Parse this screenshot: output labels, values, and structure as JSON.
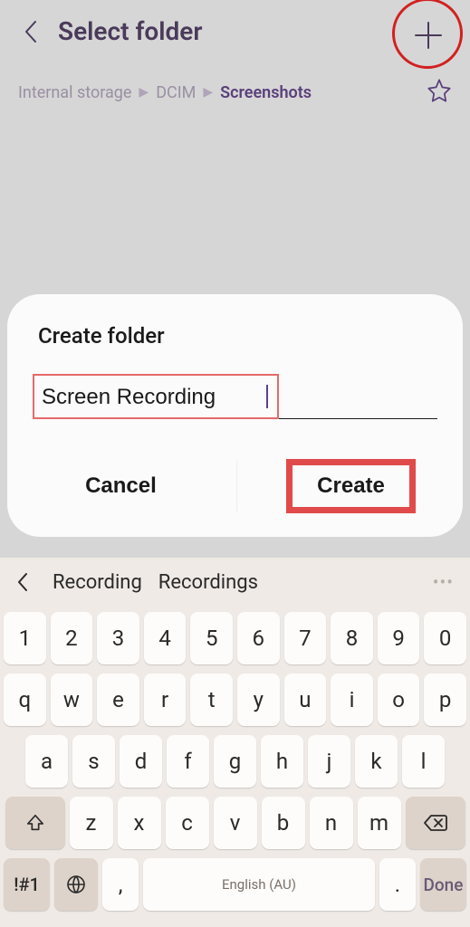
{
  "header": {
    "title": "Select folder"
  },
  "breadcrumb": {
    "items": [
      "Internal storage",
      "DCIM",
      "Screenshots"
    ]
  },
  "dialog": {
    "title": "Create folder",
    "input_value": "Screen Recording",
    "cancel_label": "Cancel",
    "create_label": "Create"
  },
  "keyboard": {
    "suggestions": [
      "Recording",
      "Recordings"
    ],
    "rows": {
      "numbers": [
        "1",
        "2",
        "3",
        "4",
        "5",
        "6",
        "7",
        "8",
        "9",
        "0"
      ],
      "row1": [
        "q",
        "w",
        "e",
        "r",
        "t",
        "y",
        "u",
        "i",
        "o",
        "p"
      ],
      "row2": [
        "a",
        "s",
        "d",
        "f",
        "g",
        "h",
        "j",
        "k",
        "l"
      ],
      "row3": [
        "z",
        "x",
        "c",
        "v",
        "b",
        "n",
        "m"
      ]
    },
    "symbol_key": "!#1",
    "comma_key": ",",
    "period_key": ".",
    "space_label": "English (AU)",
    "done_label": "Done"
  }
}
